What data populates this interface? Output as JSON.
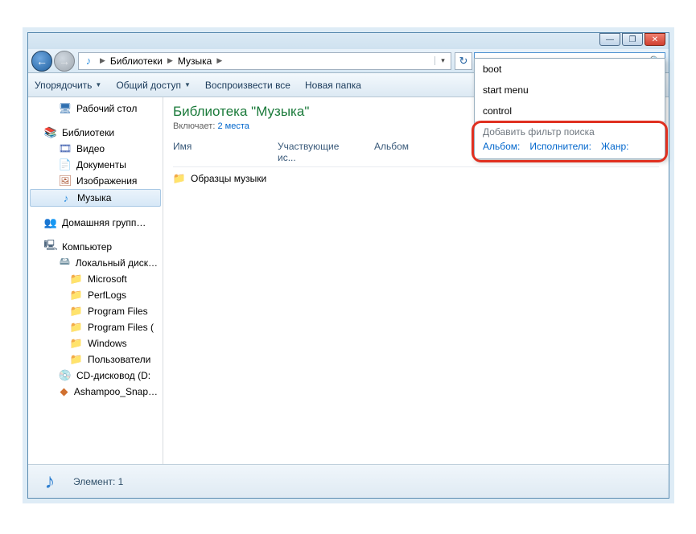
{
  "win_controls": {
    "min": "—",
    "max": "❐",
    "close": "✕"
  },
  "nav": {
    "back": "←",
    "fwd": "→",
    "refresh": "↻"
  },
  "breadcrumb": {
    "root": "Библиотеки",
    "current": "Музыка",
    "sep": "▶"
  },
  "search": {
    "placeholder": "",
    "icon": "🔍"
  },
  "toolbar": {
    "organize": "Упорядочить",
    "share": "Общий доступ",
    "play_all": "Воспроизвести все",
    "new_folder": "Новая папка",
    "arrow": "▼"
  },
  "sidebar": {
    "desktop": "Рабочий стол",
    "libraries": "Библиотеки",
    "video": "Видео",
    "documents": "Документы",
    "images": "Изображения",
    "music": "Музыка",
    "homegroup": "Домашняя групп…",
    "computer": "Компьютер",
    "localdisk": "Локальный диск…",
    "microsoft": "Microsoft",
    "perflogs": "PerfLogs",
    "progfiles": "Program Files",
    "progfiles2": "Program Files (",
    "windows": "Windows",
    "users": "Пользователи",
    "cd": "CD-дисковод (D:",
    "ashampoo": "Ashampoo_Snap…"
  },
  "content": {
    "title": "Библиотека \"Музыка\"",
    "includes_label": "Включает:",
    "includes_link": "2 места",
    "col_name": "Имя",
    "col_artists": "Участвующие ис...",
    "col_album": "Альбом",
    "item1": "Образцы музыки"
  },
  "status": {
    "label": "Элемент: 1"
  },
  "dropdown": {
    "h1": "boot",
    "h2": "start menu",
    "h3": "control",
    "filter_title": "Добавить фильтр поиска",
    "f_album": "Альбом:",
    "f_artists": "Исполнители:",
    "f_genre": "Жанр:"
  }
}
